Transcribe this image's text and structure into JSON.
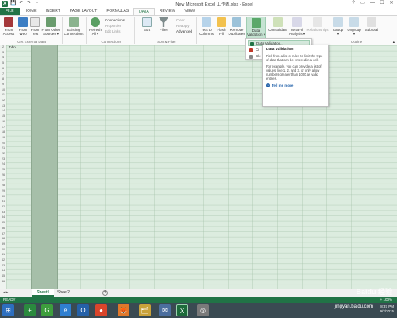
{
  "window": {
    "title": "New Microsoft Excel 工作表.xlsx - Excel",
    "app_logo": "X",
    "controls": [
      "?",
      "▭",
      "—",
      "☐",
      "✕"
    ]
  },
  "qat": [
    "💾",
    "↶",
    "↷",
    "▾"
  ],
  "tabs": [
    "FILE",
    "HOME",
    "INSERT",
    "PAGE LAYOUT",
    "FORMULAS",
    "DATA",
    "REVIEW",
    "VIEW"
  ],
  "active_tab": "DATA",
  "ribbon": {
    "get_external_data": {
      "group": "Get External Data",
      "buttons": [
        {
          "l1": "From",
          "l2": "Access"
        },
        {
          "l1": "From",
          "l2": "Web"
        },
        {
          "l1": "From",
          "l2": "Text"
        },
        {
          "l1": "From Other",
          "l2": "Sources ▾"
        }
      ]
    },
    "existing": {
      "l1": "Existing",
      "l2": "Connections"
    },
    "connections": {
      "group": "Connections",
      "refresh": {
        "l1": "Refresh",
        "l2": "All ▾"
      },
      "items": [
        "Connections",
        "Properties",
        "Edit Links"
      ]
    },
    "sort_filter": {
      "group": "Sort & Filter",
      "sort": "Sort",
      "filter": "Filter",
      "items": [
        "Clear",
        "Reapply",
        "Advanced"
      ]
    },
    "data_tools": {
      "group": "Data Tools",
      "buttons": [
        {
          "l1": "Text to",
          "l2": "Columns"
        },
        {
          "l1": "Flash",
          "l2": "Fill"
        },
        {
          "l1": "Remove",
          "l2": "Duplicates"
        },
        {
          "l1": "Data",
          "l2": "Validation ▾"
        },
        {
          "l1": "Consolidate",
          "l2": ""
        },
        {
          "l1": "What-If",
          "l2": "Analysis ▾"
        },
        {
          "l1": "Relationships",
          "l2": ""
        }
      ]
    },
    "outline": {
      "group": "Outline",
      "buttons": [
        {
          "l1": "Group",
          "l2": "▾"
        },
        {
          "l1": "Ungroup",
          "l2": "▾"
        },
        {
          "l1": "Subtotal",
          "l2": ""
        }
      ]
    }
  },
  "dropdown": {
    "items": [
      "Data Validation...",
      "Ci",
      "Cle"
    ]
  },
  "tooltip": {
    "title": "Data Validation",
    "p1": "Pick from a list of rules to limit the type of data that can be entered in a cell.",
    "p2": "For example, you can provide a list of values, like 1, 2, and 3, or only allow numbers greater than 1000 as valid entries.",
    "link": "Tell me more"
  },
  "grid": {
    "cell_a2": "John",
    "rows": [
      "2",
      "3",
      "4",
      "5",
      "6",
      "7",
      "8",
      "9",
      "10",
      "11",
      "12",
      "13",
      "14",
      "15",
      "16",
      "17",
      "18",
      "19",
      "20",
      "21",
      "22",
      "23",
      "24",
      "25",
      "26",
      "27",
      "28",
      "29",
      "30",
      "31",
      "32",
      "33",
      "34",
      "35",
      "36",
      "37",
      "38",
      "39",
      "40",
      "41",
      "42",
      "43",
      "44",
      "45",
      "46"
    ]
  },
  "sheets": [
    "Sheet1",
    "Sheet2"
  ],
  "sheet_nav": "◂ ▸",
  "add_sheet": "+",
  "status": {
    "ready": "READY",
    "zoom": "+ 100%"
  },
  "taskbar": {
    "start": "⊞",
    "apps": [
      "+",
      "G",
      "e",
      "O",
      "●",
      "🦊",
      "🗂",
      "✉",
      "X",
      "◎"
    ],
    "time": "8:37 PM",
    "date": "9/2/2015"
  },
  "watermark": {
    "main": "Baidu 经验",
    "sub": "jingyan.baidu.com"
  },
  "colors": {
    "excel_green": "#217346",
    "grid_bg": "#dcecdf",
    "selected_col": "#a6bfa9"
  }
}
